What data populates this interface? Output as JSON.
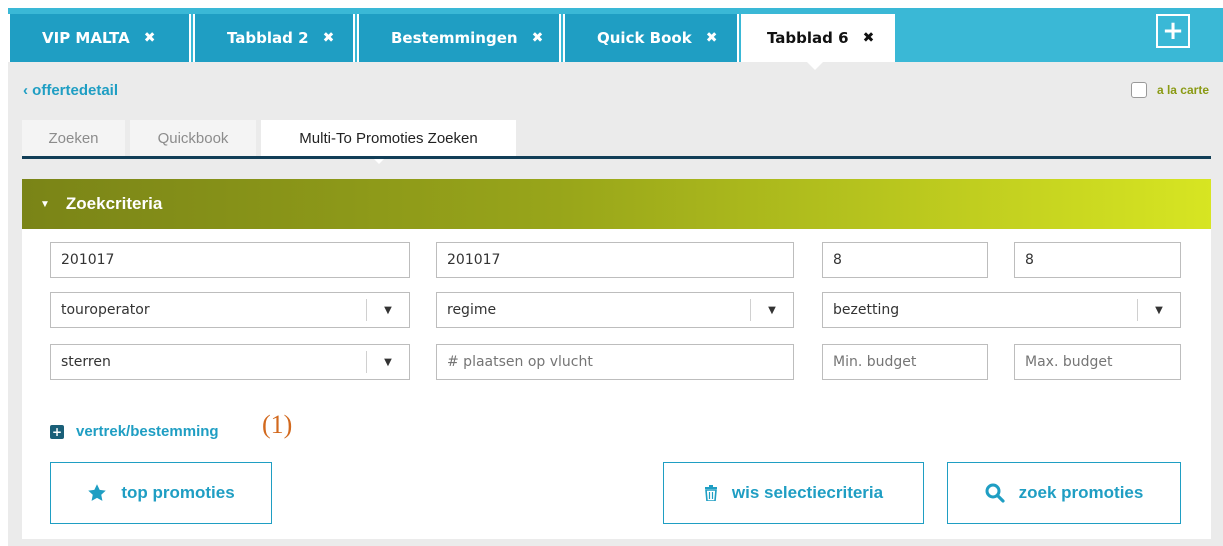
{
  "tabs": [
    {
      "label": "VIP MALTA",
      "close": "✖"
    },
    {
      "label": "Tabblad 2",
      "close": "✖"
    },
    {
      "label": "Bestemmingen",
      "close": "✖"
    },
    {
      "label": "Quick Book",
      "close": "✖"
    },
    {
      "label": "Tabblad 6",
      "close": "✖"
    }
  ],
  "new_tab_icon": "plus-icon",
  "back_link": "‹ offertedetail",
  "alacarte_label": "a la carte",
  "subtabs": [
    "Zoeken",
    "Quickbook",
    "Multi-To Promoties Zoeken"
  ],
  "panel": {
    "title": "Zoekcriteria",
    "date_from": "201017",
    "date_to": "201017",
    "num_a": "8",
    "num_b": "8",
    "touroperator": "touroperator",
    "regime": "regime",
    "bezetting": "bezetting",
    "sterren": "sterren",
    "seats_placeholder": "# plaatsen op vlucht",
    "min_budget_placeholder": "Min. budget",
    "max_budget_placeholder": "Max. budget",
    "expand_label": "vertrek/bestemming",
    "annotation": "(1)"
  },
  "buttons": {
    "top_promoties": "top promoties",
    "wis": "wis selectiecriteria",
    "zoek": "zoek promoties"
  },
  "colors": {
    "tabbar": "#3ab8d6",
    "tab": "#1f9ec3",
    "accent": "#1f9ec3",
    "header_start": "#7a8417",
    "header_end": "#d7e522"
  }
}
